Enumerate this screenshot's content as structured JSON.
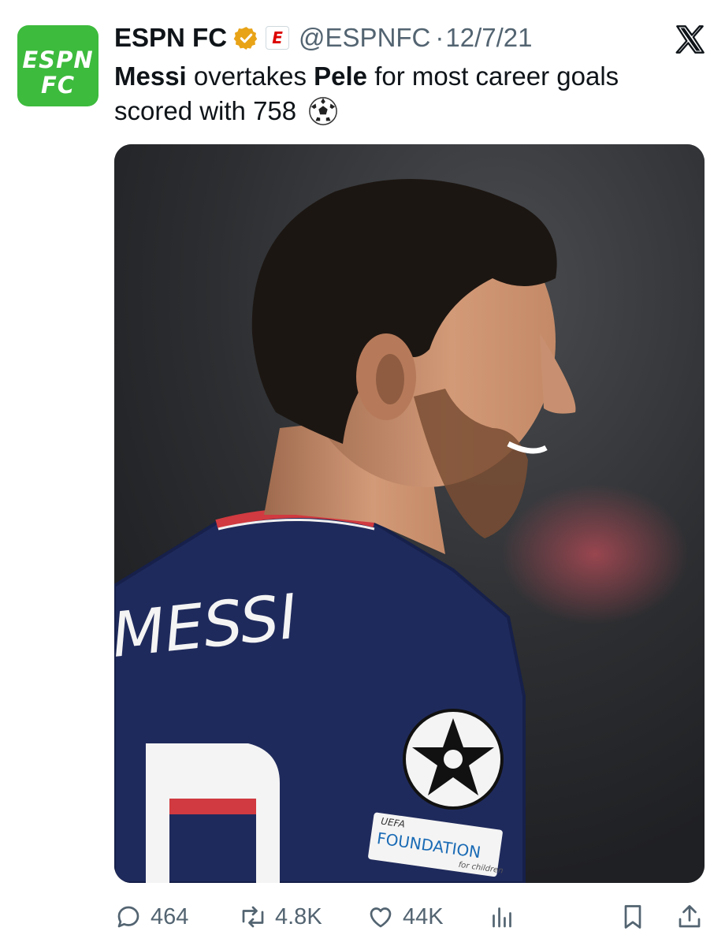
{
  "account": {
    "logo_line1": "ESPN",
    "logo_line2": "FC",
    "name": "ESPN FC",
    "badge_letter": "E",
    "handle": "@ESPNFC",
    "separator": "·",
    "date": "12/7/21"
  },
  "tweet": {
    "bold1": "Messi",
    "text1": " overtakes ",
    "bold2": "Pele",
    "text2": " for most career goals scored with 758",
    "emoji_icon": "soccer-ball-icon"
  },
  "media": {
    "jersey_name": "MESSI",
    "patch_small": "UEFA",
    "patch_main": "FOUNDATION",
    "patch_sub": "for children",
    "colors": {
      "jersey": "#1f2a5c",
      "background": "#2b2d30",
      "skin": "#c48a68",
      "hair": "#1c1612"
    }
  },
  "actions": {
    "replies": "464",
    "reposts": "4.8K",
    "likes": "44K",
    "icons": [
      "reply-icon",
      "repost-icon",
      "like-icon",
      "views-icon",
      "bookmark-icon",
      "share-icon"
    ]
  },
  "colors": {
    "brand_green": "#3dbb3d",
    "muted": "#536471",
    "verified_gold": "#e8a317",
    "text": "#0f1419"
  }
}
